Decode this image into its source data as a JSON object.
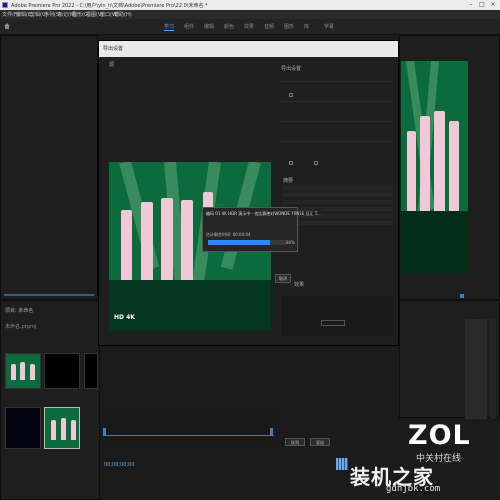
{
  "window": {
    "title": "Adobe Premiere Pro 2022 - C:\\用户\\yin_h\\文档\\Adobe\\Premiere Pro\\22.0\\未命名 *"
  },
  "menu": [
    "文件(F)",
    "编辑(E)",
    "剪辑(C)",
    "序列(S)",
    "标记(M)",
    "图形(G)",
    "视图(V)",
    "窗口(W)",
    "帮助(H)"
  ],
  "workspace_tabs": [
    "学习",
    "组件",
    "编辑",
    "颜色",
    "效果",
    "音频",
    "图形",
    "库",
    "字幕"
  ],
  "dialog": {
    "title": "导出设置",
    "source_label": "源",
    "export_settings_label": "导出设置",
    "summary_label": "摘要",
    "effects_label": "效果",
    "video_overlay": "HD 4K"
  },
  "progress": {
    "title": "编码 01 4K HDR 演示中 - 也比赛绝对WONDE 70N1E 日汇 T...",
    "label": "估计剩余时间: 00:00:04",
    "percent": 80,
    "percent_text": "80%"
  },
  "buttons": {
    "cancel": "取消",
    "export": "导出",
    "queue": "队列"
  },
  "project_panel": {
    "title": "项目: 未命名",
    "file": "未命名.prproj"
  },
  "timeline": {
    "timecode": "00;00;00;00"
  },
  "watermark": {
    "logo": "ZOL",
    "subtitle": "中关村在线",
    "site_cn": "装机之家",
    "url": "gdhjbk.com"
  },
  "colors": {
    "accent": "#2d8ceb",
    "stage_green": "#0c6b3c",
    "title_bar": "#ececec"
  }
}
